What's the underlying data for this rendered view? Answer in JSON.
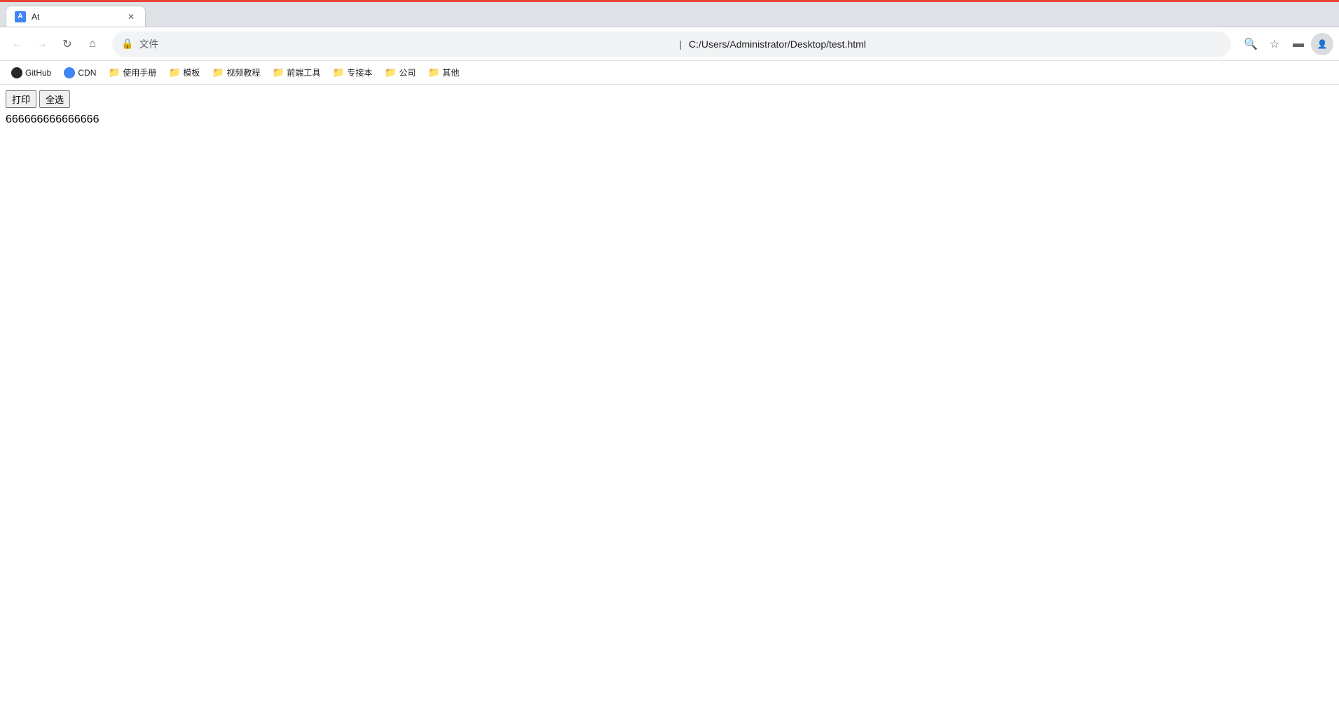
{
  "browser": {
    "top_bar_color": "#ea4335",
    "tab": {
      "title": "At",
      "favicon_letter": "A"
    },
    "nav": {
      "url": "C:/Users/Administrator/Desktop/test.html",
      "protocol": "文件"
    },
    "bookmarks": [
      {
        "label": "GitHub",
        "type": "github"
      },
      {
        "label": "CDN",
        "type": "cdn"
      },
      {
        "label": "使用手册",
        "type": "folder"
      },
      {
        "label": "模板",
        "type": "folder"
      },
      {
        "label": "视频教程",
        "type": "folder"
      },
      {
        "label": "前端工具",
        "type": "folder"
      },
      {
        "label": "专接本",
        "type": "folder"
      },
      {
        "label": "公司",
        "type": "folder"
      },
      {
        "label": "其他",
        "type": "folder"
      }
    ]
  },
  "page": {
    "print_button_label": "打印",
    "select_all_button_label": "全选",
    "content_text": "666666666666666"
  }
}
